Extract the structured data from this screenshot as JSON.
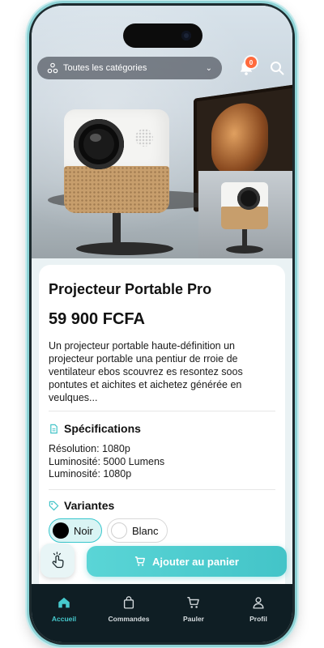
{
  "header": {
    "category_select": "Toutes les catégories",
    "notification_count": "0"
  },
  "product": {
    "title": "Projecteur Portable Pro",
    "price": "59 900 FCFA",
    "description": "Un projecteur portable haute-définition un projecteur portable una pentiur de rroie de ventilateur ebos scouvrez es resontez soos pontutes et aichites et aichetez générée en veulques..."
  },
  "specs": {
    "heading": "Spécifications",
    "lines": [
      "Résolution: 1080p",
      "Luminosité: 5000 Lumens",
      "Luminosité: 1080p"
    ]
  },
  "variants": {
    "heading": "Variantes",
    "options": [
      {
        "label": "Noir",
        "color": "#000000"
      },
      {
        "label": "Blanc",
        "color": "#ffffff"
      }
    ]
  },
  "actions": {
    "add_to_cart": "Ajouter au panier"
  },
  "nav": {
    "items": [
      {
        "label": "Accueil",
        "icon": "home-icon"
      },
      {
        "label": "Commandes",
        "icon": "bag-icon"
      },
      {
        "label": "Pauler",
        "icon": "cart-icon"
      },
      {
        "label": "Profil",
        "icon": "user-icon"
      }
    ]
  },
  "colors": {
    "accent": "#43c4c8",
    "nav_bg": "#0f1e24",
    "badge": "#ff6a3d"
  }
}
